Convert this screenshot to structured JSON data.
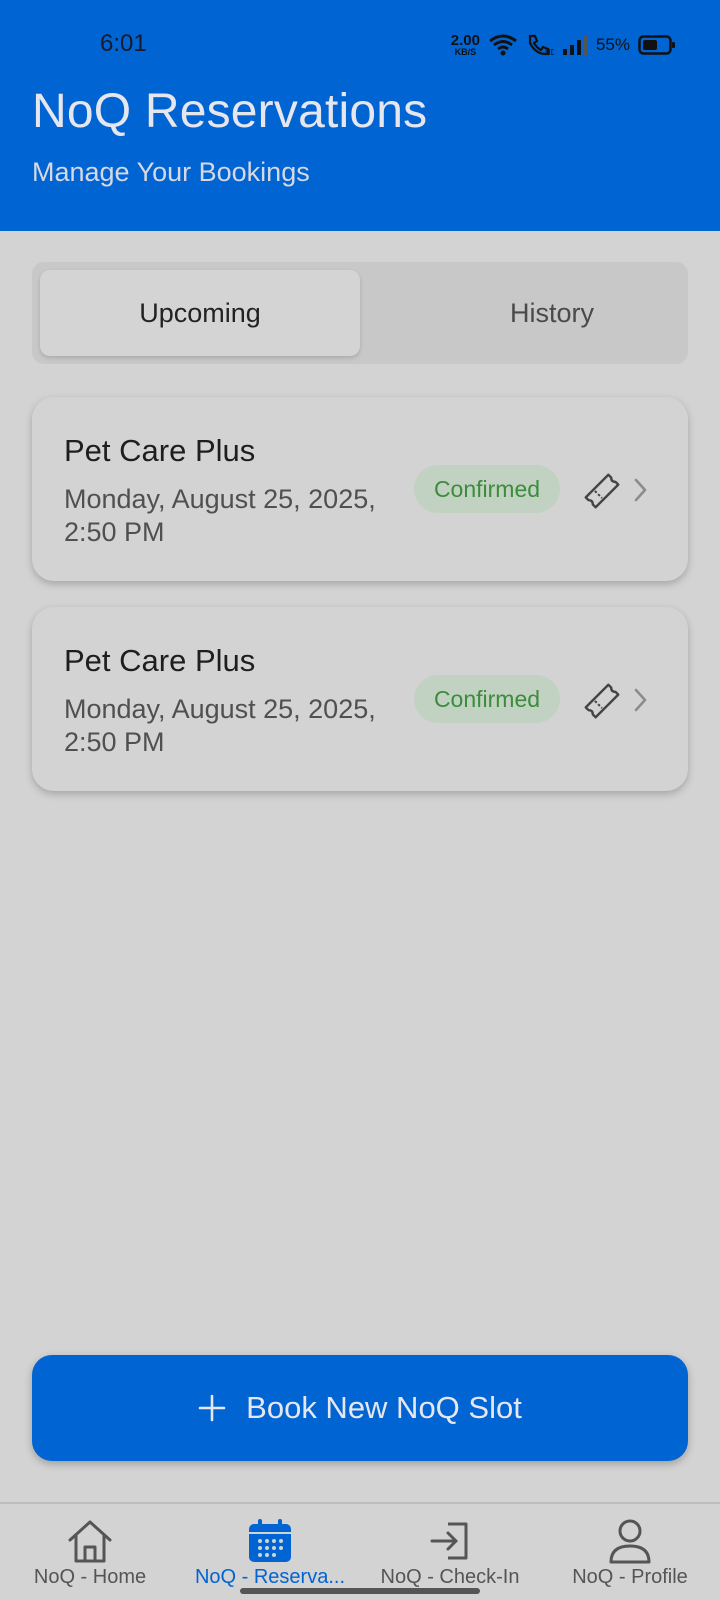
{
  "status_bar": {
    "time": "6:01",
    "net_speed_value": "2.00",
    "net_speed_unit": "KB/S",
    "battery_percent": "55%",
    "icons": [
      "wifi-icon",
      "call-icon",
      "signal-icon",
      "battery-icon"
    ]
  },
  "header": {
    "title": "NoQ Reservations",
    "subtitle": "Manage Your Bookings"
  },
  "tabs": [
    {
      "label": "Upcoming",
      "active": true
    },
    {
      "label": "History",
      "active": false
    }
  ],
  "reservations": [
    {
      "title": "Pet Care Plus",
      "datetime": "Monday, August 25, 2025, 2:50 PM",
      "status": "Confirmed"
    },
    {
      "title": "Pet Care Plus",
      "datetime": "Monday, August 25, 2025, 2:50 PM",
      "status": "Confirmed"
    }
  ],
  "book_button": {
    "label": "Book New NoQ Slot",
    "icon": "plus-icon"
  },
  "bottom_nav": [
    {
      "label": "NoQ - Home",
      "icon": "home-icon",
      "active": false
    },
    {
      "label": "NoQ - Reserva...",
      "icon": "calendar-icon",
      "active": true
    },
    {
      "label": "NoQ - Check-In",
      "icon": "check-in-icon",
      "active": false
    },
    {
      "label": "NoQ - Profile",
      "icon": "person-icon",
      "active": false
    }
  ],
  "colors": {
    "primary": "#0064d2",
    "background": "#d3d3d3",
    "confirmed_text": "#3b8c3b",
    "confirmed_bg": "#c2d2c2"
  }
}
